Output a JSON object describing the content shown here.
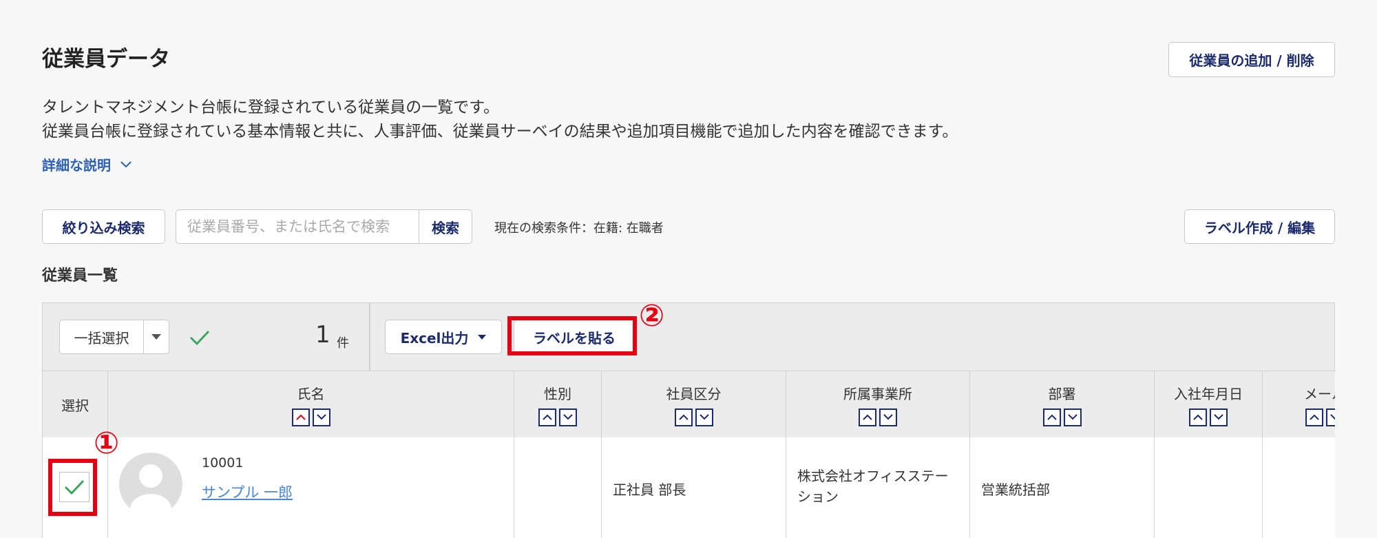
{
  "page": {
    "title": "従業員データ",
    "add_remove_button": "従業員の追加 / 削除",
    "description_line1": "タレントマネジメント台帳に登録されている従業員の一覧です。",
    "description_line2": "従業員台帳に登録されている基本情報と共に、人事評価、従業員サーベイの結果や追加項目機能で追加した内容を確認できます。",
    "detail_link": "詳細な説明"
  },
  "search": {
    "filter_button": "絞り込み検索",
    "placeholder": "従業員番号、または氏名で検索",
    "value": "",
    "search_button": "検索",
    "current_condition": "現在の検索条件：在籍: 在職者",
    "label_edit_button": "ラベル作成 / 編集"
  },
  "list": {
    "title": "従業員一覧",
    "bulk_select": "一括選択",
    "selected_count": "1",
    "count_unit": "件",
    "excel_button": "Excel出力",
    "label_button": "ラベルを貼る"
  },
  "annotations": {
    "marker1": "①",
    "marker2": "②",
    "highlight_color": "#e60012"
  },
  "table": {
    "columns": [
      "選択",
      "氏名",
      "性別",
      "社員区分",
      "所属事業所",
      "部署",
      "入社年月日",
      "メール"
    ],
    "rows": [
      {
        "selected": true,
        "employee_number": "10001",
        "name": "サンプル 一郎",
        "gender": "",
        "employee_type": "正社員 部長",
        "office_line1": "株式会社オフィスステー",
        "office_line2": "ション",
        "department": "営業統括部",
        "join_date": ""
      }
    ]
  },
  "colors": {
    "accent": "#1a2a6c",
    "link": "#2b5fb3",
    "check": "#3aa55d"
  }
}
